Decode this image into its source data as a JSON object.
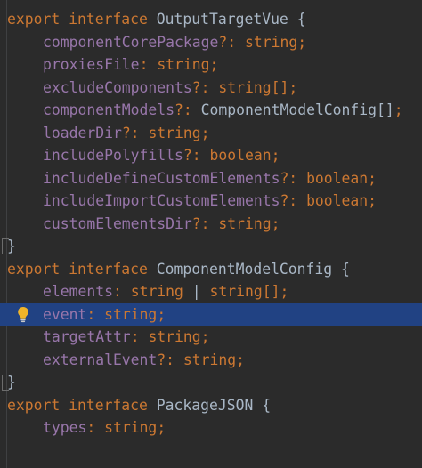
{
  "colors": {
    "background": "#2b2b2b",
    "highlight": "#214283",
    "keyword": "#cc7832",
    "property": "#9876aa",
    "text": "#a9b7c6"
  },
  "code": {
    "l1": {
      "kw1": "export",
      "kw2": "interface",
      "name": "OutputTargetVue",
      "brace": "{"
    },
    "l2": {
      "prop": "componentCorePackage",
      "punct1": "?:",
      "type": "string",
      "punct2": ";"
    },
    "l3": {
      "prop": "proxiesFile",
      "punct1": ":",
      "type": "string",
      "punct2": ";"
    },
    "l4": {
      "prop": "excludeComponents",
      "punct1": "?:",
      "type": "string[]",
      "punct2": ";"
    },
    "l5": {
      "prop": "componentModels",
      "punct1": "?:",
      "type": "ComponentModelConfig[]",
      "punct2": ";"
    },
    "l6": {
      "prop": "loaderDir",
      "punct1": "?:",
      "type": "string",
      "punct2": ";"
    },
    "l7": {
      "prop": "includePolyfills",
      "punct1": "?:",
      "type": "boolean",
      "punct2": ";"
    },
    "l8": {
      "prop": "includeDefineCustomElements",
      "punct1": "?:",
      "type": "boolean",
      "punct2": ";"
    },
    "l9": {
      "prop": "includeImportCustomElements",
      "punct1": "?:",
      "type": "boolean",
      "punct2": ";"
    },
    "l10": {
      "prop": "customElementsDir",
      "punct1": "?:",
      "type": "string",
      "punct2": ";"
    },
    "l11": {
      "brace": "}"
    },
    "l12": {
      "kw1": "export",
      "kw2": "interface",
      "name": "ComponentModelConfig",
      "brace": "{"
    },
    "l13": {
      "prop": "elements",
      "punct1": ":",
      "type": "string",
      "bar": "|",
      "type2": "string[]",
      "punct2": ";"
    },
    "l14": {
      "prop": "event",
      "punct1": ":",
      "type": "string",
      "punct2": ";"
    },
    "l15": {
      "prop": "targetAttr",
      "punct1": ":",
      "type": "string",
      "punct2": ";"
    },
    "l16": {
      "prop": "externalEvent",
      "punct1": "?:",
      "type": "string",
      "punct2": ";"
    },
    "l17": {
      "brace": "}"
    },
    "l18": {
      "kw1": "export",
      "kw2": "interface",
      "name": "PackageJSON",
      "brace": "{"
    },
    "l19": {
      "prop": "types",
      "punct1": ":",
      "type": "string",
      "punct2": ";"
    }
  },
  "icons": {
    "intention": "lightbulb-icon"
  }
}
